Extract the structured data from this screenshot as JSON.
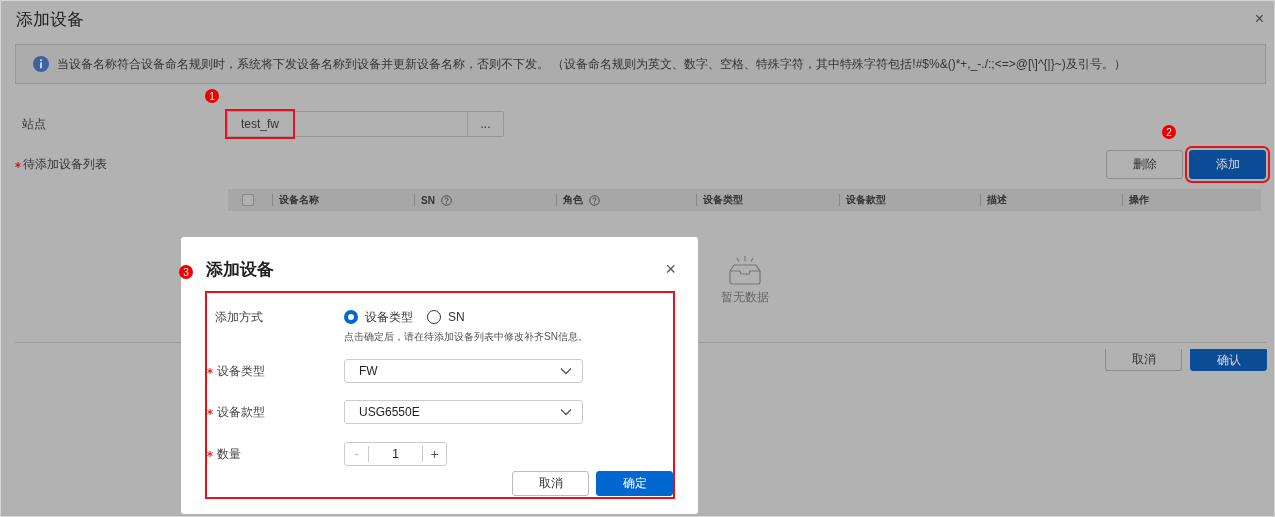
{
  "window": {
    "title": "添加设备",
    "close": "×"
  },
  "notice": {
    "text": "当设备名称符合设备命名规则时，系统将下发设备名称到设备并更新设备名称，否则不下发。 （设备命名规则为英文、数字、空格、特殊字符，其中特殊字符包括!#$%&()*+,_-./:;<=>@[\\]^{|}~)及引号。）"
  },
  "site": {
    "label": "站点",
    "value": "test_fw",
    "browse": "...",
    "highlighted": true
  },
  "device_list": {
    "label": "待添加设备列表",
    "required": true,
    "buttons": [
      {
        "label": "删除",
        "kind": "secondary",
        "highlighted": false
      },
      {
        "label": "添加",
        "kind": "primary",
        "highlighted": true
      }
    ],
    "select_all_checked": false,
    "columns": [
      {
        "label": "设备名称",
        "help": false
      },
      {
        "label": "SN",
        "help": true
      },
      {
        "label": "角色",
        "help": true
      },
      {
        "label": "设备类型",
        "help": false
      },
      {
        "label": "设备款型",
        "help": false
      },
      {
        "label": "描述",
        "help": false
      },
      {
        "label": "操作",
        "help": false
      }
    ],
    "empty_text": "暂无数据"
  },
  "footer_buttons": [
    {
      "label": "取消",
      "kind": "secondary"
    },
    {
      "label": "确认",
      "kind": "primary"
    }
  ],
  "annotations": [
    {
      "number": "1"
    },
    {
      "number": "2"
    },
    {
      "number": "3"
    }
  ],
  "dialog": {
    "title": "添加设备",
    "close": "×",
    "form_highlighted": true,
    "fields": [
      {
        "kind": "radio",
        "label": "添加方式",
        "required": false,
        "options": [
          {
            "label": "设备类型",
            "selected": true
          },
          {
            "label": "SN",
            "selected": false
          }
        ],
        "hint": "点击确定后，请在待添加设备列表中修改补齐SN信息。"
      },
      {
        "kind": "select",
        "label": "设备类型",
        "required": true,
        "value": "FW"
      },
      {
        "kind": "select",
        "label": "设备款型",
        "required": true,
        "value": "USG6550E"
      },
      {
        "kind": "stepper",
        "label": "数量",
        "required": true,
        "value": "1",
        "decrement": "-",
        "increment": "+"
      }
    ],
    "buttons": [
      {
        "label": "取消",
        "kind": "secondary"
      },
      {
        "label": "确定",
        "kind": "primary"
      }
    ]
  }
}
